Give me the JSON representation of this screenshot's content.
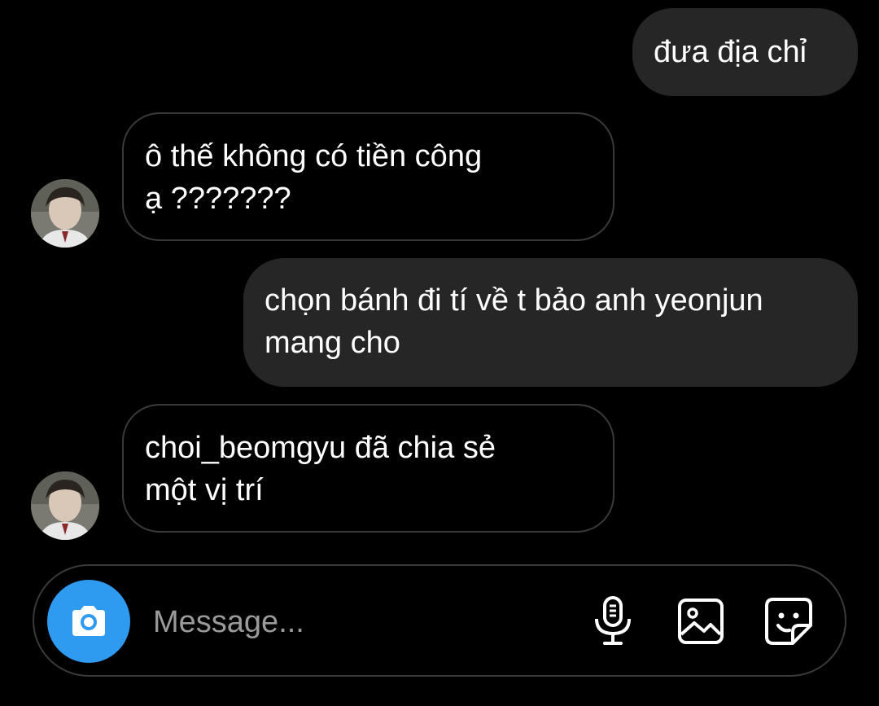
{
  "messages": [
    {
      "direction": "sent",
      "text": "đưa địa chỉ"
    },
    {
      "direction": "received",
      "text": "ô thế không có tiền công\nạ ???????"
    },
    {
      "direction": "sent",
      "text": "chọn bánh đi tí về t bảo anh yeonjun\nmang cho"
    },
    {
      "direction": "received",
      "text": "choi_beomgyu đã chia sẻ\nmột vị trí"
    }
  ],
  "composer": {
    "placeholder": "Message..."
  },
  "icons": {
    "camera": "camera-icon",
    "microphone": "microphone-icon",
    "gallery": "gallery-icon",
    "sticker": "sticker-icon"
  },
  "colors": {
    "background": "#000000",
    "sent_bubble": "#262626",
    "received_border": "#3a3a3a",
    "camera_button": "#2e9bf0",
    "placeholder": "#9a9a9a"
  }
}
